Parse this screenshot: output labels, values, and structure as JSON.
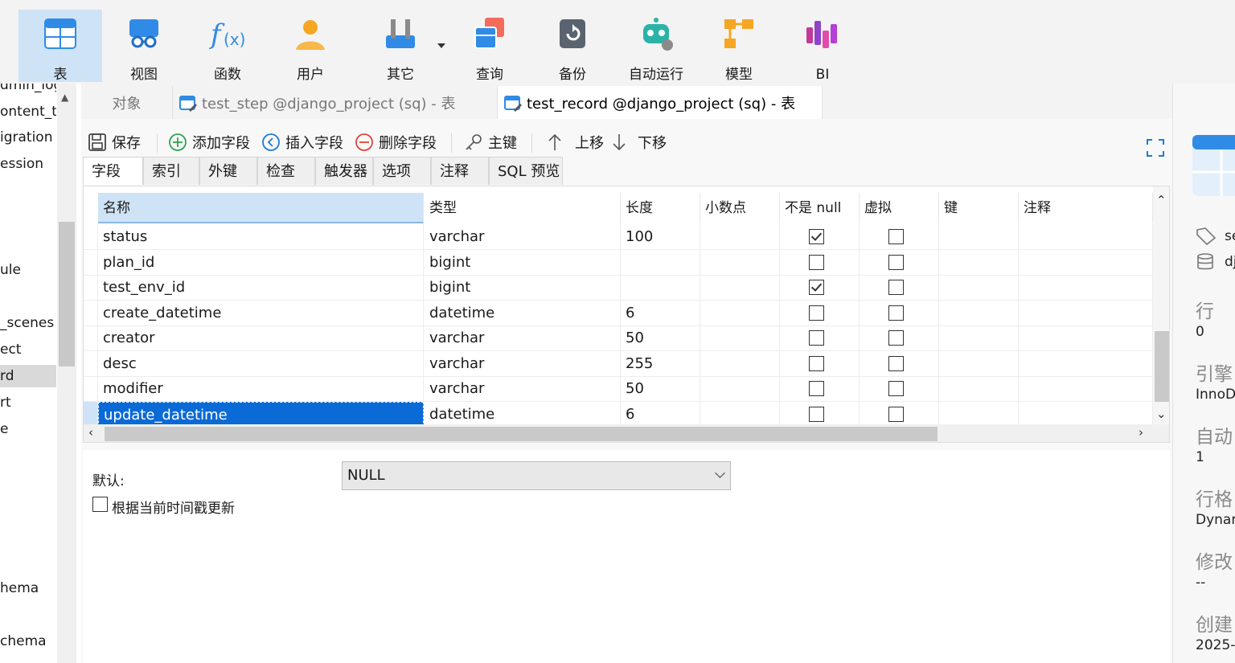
{
  "ribbon": {
    "items": [
      {
        "label": "表",
        "icon": "table-icon"
      },
      {
        "label": "视图",
        "icon": "view-icon"
      },
      {
        "label": "函数",
        "icon": "function-icon"
      },
      {
        "label": "用户",
        "icon": "user-icon"
      },
      {
        "label": "其它",
        "icon": "tools-icon"
      },
      {
        "label": "查询",
        "icon": "query-icon"
      },
      {
        "label": "备份",
        "icon": "backup-icon"
      },
      {
        "label": "自动运行",
        "icon": "robot-icon"
      },
      {
        "label": "模型",
        "icon": "model-icon"
      },
      {
        "label": "BI",
        "icon": "bi-icon"
      }
    ],
    "active_index": 0
  },
  "nav": {
    "items": [
      "dmin_log",
      "ontent_ty",
      "igration",
      "ession",
      "ule",
      "_scenes",
      "ect",
      "rd",
      "rt",
      "e",
      "hema",
      "chema"
    ],
    "selected_index": 7
  },
  "tabs": [
    {
      "label": "对象"
    },
    {
      "label": "test_step @django_project (sq) - 表"
    },
    {
      "label": "test_record @django_project (sq) - 表"
    }
  ],
  "toolbar": {
    "save": "保存",
    "add_field": "添加字段",
    "insert_field": "插入字段",
    "delete_field": "删除字段",
    "primary_key": "主键",
    "move_up": "上移",
    "move_down": "下移"
  },
  "subtabs": [
    "字段",
    "索引",
    "外键",
    "检查",
    "触发器",
    "选项",
    "注释",
    "SQL 预览"
  ],
  "grid": {
    "headers": [
      "名称",
      "类型",
      "长度",
      "小数点",
      "不是 null",
      "虚拟",
      "键",
      "注释"
    ],
    "rows": [
      {
        "name": "status",
        "type": "varchar",
        "length": "100",
        "decimals": "",
        "not_null": true,
        "virtual": false
      },
      {
        "name": "plan_id",
        "type": "bigint",
        "length": "",
        "decimals": "",
        "not_null": false,
        "virtual": false
      },
      {
        "name": "test_env_id",
        "type": "bigint",
        "length": "",
        "decimals": "",
        "not_null": true,
        "virtual": false
      },
      {
        "name": "create_datetime",
        "type": "datetime",
        "length": "6",
        "decimals": "",
        "not_null": false,
        "virtual": false
      },
      {
        "name": "creator",
        "type": "varchar",
        "length": "50",
        "decimals": "",
        "not_null": false,
        "virtual": false
      },
      {
        "name": "desc",
        "type": "varchar",
        "length": "255",
        "decimals": "",
        "not_null": false,
        "virtual": false
      },
      {
        "name": "modifier",
        "type": "varchar",
        "length": "50",
        "decimals": "",
        "not_null": false,
        "virtual": false
      },
      {
        "name": "update_datetime",
        "type": "datetime",
        "length": "6",
        "decimals": "",
        "not_null": false,
        "virtual": false
      }
    ],
    "selected_row": 7
  },
  "detail": {
    "default_label": "默认:",
    "default_value": "NULL",
    "timestamp_update_label": "根据当前时间戳更新"
  },
  "rightpanel": {
    "name_fragment": "se",
    "db_fragment": "dj",
    "rows_label": "行",
    "rows_value": "0",
    "engine_label": "引擎",
    "engine_value": "InnoD",
    "auto_label": "自动",
    "auto_value": "1",
    "format_label": "行格",
    "format_value": "Dynar",
    "modified_label": "修改",
    "modified_value": "--",
    "created_label": "创建",
    "created_value": "2025-"
  },
  "colors": {
    "accent": "#0a6ad6",
    "ribbon_active": "#cfe3f7",
    "header_selected": "#cfe3f7"
  }
}
